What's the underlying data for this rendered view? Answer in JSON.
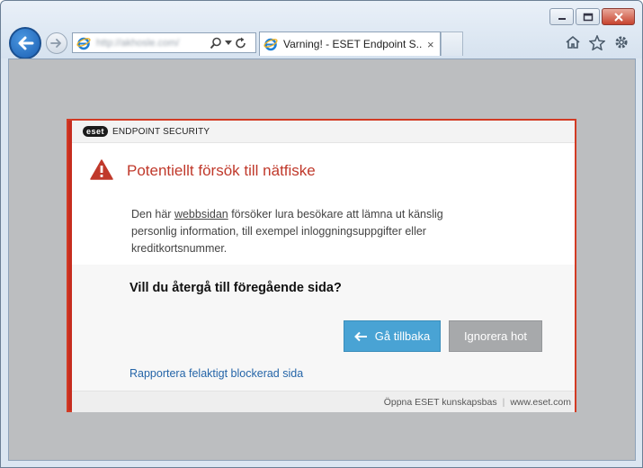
{
  "browser": {
    "address": "http://akhosle.com/",
    "tab_title": "Varning! - ESET Endpoint S...",
    "tab_close": "×",
    "icons": {
      "back": "back-arrow-icon",
      "forward": "forward-arrow-icon",
      "site": "ie-logo-icon",
      "search": "search-icon",
      "refresh": "refresh-icon",
      "home": "home-icon",
      "favorites": "star-icon",
      "tools": "gear-icon"
    }
  },
  "eset": {
    "logo": "eset",
    "product": "ENDPOINT SECURITY",
    "warning_title": "Potentiellt försök till nätfiske",
    "body_before_link": "Den här ",
    "body_link": "webbsidan",
    "body_after_link": " försöker lura besökare att lämna ut känslig personlig information, till exempel inloggningsuppgifter eller kreditkortsnummer.",
    "question": "Vill du återgå till föregående sida?",
    "back_button": "Gå tillbaka",
    "ignore_button": "Ignorera hot",
    "report_link": "Rapportera felaktigt blockerad sida",
    "footer_kb": "Öppna ESET kunskapsbas",
    "footer_sep": "|",
    "footer_site": "www.eset.com"
  },
  "colors": {
    "accent_red": "#c62d1f",
    "title_red": "#c0392b",
    "button_blue": "#49a3d4",
    "button_gray": "#a7a9ab",
    "link_blue": "#2565a8"
  }
}
